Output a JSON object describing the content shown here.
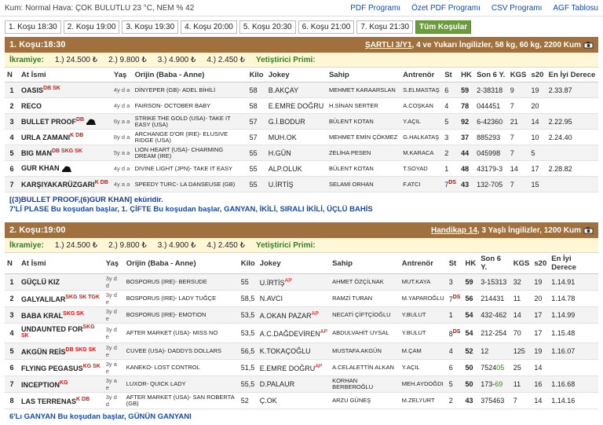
{
  "header": {
    "weather": "Kum: Normal Hava: ÇOK BULUTLU 23 °C, NEM % 42",
    "links": [
      "PDF Programı",
      "Özet PDF Programı",
      "CSV Programı",
      "AGF Tablosu"
    ]
  },
  "tabs": [
    "1. Koşu 18:30",
    "2. Koşu 19:00",
    "3. Koşu 19:30",
    "4. Koşu 20:00",
    "5. Koşu 20:30",
    "6. Koşu 21:00",
    "7. Koşu 21:30",
    "Tüm Koşular"
  ],
  "columns": [
    "N",
    "At İsmi",
    "Yaş",
    "Orijin (Baba - Anne)",
    "Kilo",
    "Jokey",
    "Sahip",
    "Antrenör",
    "St",
    "HK",
    "Son 6 Y.",
    "KGS",
    "s20",
    "En İyi Derece"
  ],
  "races": [
    {
      "title": "1. Koşu:18:30",
      "cond_link": "ŞARTLI 3/Y1",
      "cond_rest": ", 4 ve Yukarı İngilizler, 58 kg, 60 kg, 2200 Kum",
      "prize_label": "İkramiye:",
      "prizes": [
        "1.) 24.500 ₺",
        "2.) 9.800 ₺",
        "3.) 4.900 ₺",
        "4.) 2.450 ₺"
      ],
      "breeder": "Yetiştirici Primi:",
      "runners": [
        {
          "n": "1",
          "name": "OASIS",
          "sup": "DB SK",
          "age": "4y d a",
          "origin": "DİNYEPER (GB)- ADEL BİHİLİ",
          "kilo": "58",
          "jockey": "B.AKÇAY",
          "jsup": "",
          "owner": "MEHMET KARAARSLAN",
          "trainer": "S.ELMASTAŞ",
          "st": "6",
          "ds": "",
          "hk": "59",
          "son": "2-38318",
          "songreen": "",
          "kgs": "9",
          "s20": "19",
          "best": "2.33.87",
          "helmet": false
        },
        {
          "n": "2",
          "name": "RECO",
          "sup": "",
          "age": "4y d a",
          "origin": "FAIRSON- OCTOBER BABY",
          "kilo": "58",
          "jockey": "E.EMRE DOĞRU",
          "jsup": "",
          "owner": "H.SİNAN SERTER",
          "trainer": "A.COŞKAN",
          "st": "4",
          "ds": "",
          "hk": "78",
          "son": "044451",
          "songreen": "",
          "kgs": "7",
          "s20": "20",
          "best": "",
          "helmet": false
        },
        {
          "n": "3",
          "name": "BULLET PROOF",
          "sup": "DB",
          "age": "6y a a",
          "origin": "STRIKE THE GOLD (USA)- TAKE IT EASY (USA)",
          "kilo": "57",
          "jockey": "G.İ.BODUR",
          "jsup": "",
          "owner": "BÜLENT KOTAN",
          "trainer": "Y.AÇIL",
          "st": "5",
          "ds": "",
          "hk": "92",
          "son": "6-42360",
          "songreen": "",
          "kgs": "21",
          "s20": "14",
          "best": "2.22.95",
          "helmet": true
        },
        {
          "n": "4",
          "name": "URLA ZAMANI",
          "sup": "K DB",
          "age": "8y d a",
          "origin": "ARCHANGE D'OR (IRE)- ELUSIVE RIDGE (USA)",
          "kilo": "57",
          "jockey": "MUH.OK",
          "jsup": "",
          "owner": "MEHMET EMİN ÇÖKMEZ",
          "trainer": "G.HALKATAŞ",
          "st": "3",
          "ds": "",
          "hk": "37",
          "son": "885293",
          "songreen": "",
          "kgs": "7",
          "s20": "10",
          "best": "2.24.40",
          "helmet": false
        },
        {
          "n": "5",
          "name": "BIG MAN",
          "sup": "DB SKG SK",
          "age": "5y a a",
          "origin": "LION HEART (USA)- CHARMING DREAM (IRE)",
          "kilo": "55",
          "jockey": "H.GÜN",
          "jsup": "",
          "owner": "ZELİHA PESEN",
          "trainer": "M.KARACA",
          "st": "2",
          "ds": "",
          "hk": "44",
          "son": "045998",
          "songreen": "",
          "kgs": "7",
          "s20": "5",
          "best": "",
          "helmet": false
        },
        {
          "n": "6",
          "name": "GUR KHAN",
          "sup": "",
          "age": "4y d a",
          "origin": "DIVINE LIGHT (JPN)- TAKE IT EASY",
          "kilo": "55",
          "jockey": "ALP.OLUK",
          "jsup": "",
          "owner": "BÜLENT KOTAN",
          "trainer": "T.SOYAD",
          "st": "1",
          "ds": "",
          "hk": "48",
          "son": "43179-3",
          "songreen": "",
          "kgs": "14",
          "s20": "17",
          "best": "2.28.82",
          "helmet": true
        },
        {
          "n": "7",
          "name": "KARŞIYAKARÜZGARI",
          "sup": "K DB",
          "age": "4y a a",
          "origin": "SPEEDY TURC- LA DANSEUSE (GB)",
          "kilo": "55",
          "jockey": "U.İRTİŞ",
          "jsup": "",
          "owner": "SELAMİ ORHAN",
          "trainer": "F.ATCI",
          "st": "7",
          "ds": "DS",
          "hk": "43",
          "son": "132-705",
          "songreen": "",
          "kgs": "7",
          "s20": "15",
          "best": "",
          "helmet": false
        }
      ],
      "note_lines": [
        {
          "text": "[(3)BULLET PROOF,(6)GUR KHAN] eküridir.",
          "cls": "dark"
        },
        {
          "text": "7'Lİ PLASE Bu koşudan başlar, 1. ÇİFTE Bu koşudan başlar, GANYAN, İKİLİ, SIRALI İKİLİ, ÜÇLÜ BAHİS",
          "cls": "blue"
        }
      ]
    },
    {
      "title": "2. Koşu:19:00",
      "cond_link": "Handikap 14",
      "cond_rest": ", 3 Yaşlı İngilizler, 1200 Kum",
      "prize_label": "İkramiye:",
      "prizes": [
        "1.) 24.500 ₺",
        "2.) 9.800 ₺",
        "3.) 4.900 ₺",
        "4.) 2.450 ₺"
      ],
      "breeder": "Yetiştirici Primi:",
      "runners": [
        {
          "n": "1",
          "name": "GÜÇLÜ KIZ",
          "sup": "",
          "age": "3y d d",
          "origin": "BOSPORUS (IRE)- BERSUDE",
          "kilo": "55",
          "jockey": "U.İRTİŞ",
          "jsup": "AP",
          "owner": "AHMET ÖZÇİLNAK",
          "trainer": "MUT.KAYA",
          "st": "3",
          "ds": "",
          "hk": "59",
          "son": "3-15313",
          "songreen": "",
          "kgs": "32",
          "s20": "19",
          "best": "1.14.91",
          "helmet": false
        },
        {
          "n": "2",
          "name": "GALYALILAR",
          "sup": "SKG SK TGK",
          "age": "3y d e",
          "origin": "BOSPORUS (IRE)- LADY TUĞÇE",
          "kilo": "58,5",
          "jockey": "N.AVCI",
          "jsup": "",
          "owner": "RAMZİ TURAN",
          "trainer": "M.YAPAROĞLU",
          "st": "7",
          "ds": "DS",
          "hk": "56",
          "son": "214431",
          "songreen": "",
          "kgs": "11",
          "s20": "20",
          "best": "1.14.78",
          "helmet": false
        },
        {
          "n": "3",
          "name": "BABA KRAL",
          "sup": "SKG SK",
          "age": "3y d e",
          "origin": "BOSPORUS (IRE)- EMOTION",
          "kilo": "53,5",
          "jockey": "A.OKAN PAZAR",
          "jsup": "AP",
          "owner": "NECATİ ÇİFTÇİOĞLU",
          "trainer": "Y.BULUT",
          "st": "1",
          "ds": "",
          "hk": "54",
          "son": "432-462",
          "songreen": "",
          "kgs": "14",
          "s20": "17",
          "best": "1.14.99",
          "helmet": false
        },
        {
          "n": "4",
          "name": "UNDAUNTED FOR",
          "sup": "SKG SK",
          "age": "3y d e",
          "origin": "AFTER MARKET (USA)- MISS NO",
          "kilo": "53,5",
          "jockey": "A.C.DAĞDEVİREN",
          "jsup": "AP",
          "owner": "ABDULVAHİT UYSAL",
          "trainer": "Y.BULUT",
          "st": "8",
          "ds": "DS",
          "hk": "54",
          "son": "212-254",
          "songreen": "",
          "kgs": "70",
          "s20": "17",
          "best": "1.15.48",
          "helmet": false
        },
        {
          "n": "5",
          "name": "AKGÜN REİS",
          "sup": "DB SKG SK",
          "age": "3y d e",
          "origin": "CUVEE (USA)- DADDYS DOLLARS",
          "kilo": "56,5",
          "jockey": "K.TOKAÇOĞLU",
          "jsup": "",
          "owner": "MUSTAFA AKGÜN",
          "trainer": "M.ÇAM",
          "st": "4",
          "ds": "",
          "hk": "52",
          "son": "12",
          "songreen": "",
          "kgs": "125",
          "s20": "19",
          "best": "1.16.07",
          "helmet": false
        },
        {
          "n": "6",
          "name": "FLYING PEGASUS",
          "sup": "KG SK",
          "age": "3y a e",
          "origin": "KANEKO- LOST CONTROL",
          "kilo": "51,5",
          "jockey": "E.EMRE DOĞRU",
          "jsup": "AP",
          "owner": "A.CELALETTİN ALKAN",
          "trainer": "Y.AÇIL",
          "st": "6",
          "ds": "",
          "hk": "50",
          "son": "7524",
          "songreen": "05",
          "kgs": "25",
          "s20": "14",
          "best": "",
          "helmet": false
        },
        {
          "n": "7",
          "name": "INCEPTION",
          "sup": "KG",
          "age": "3y a e",
          "origin": "LUXOR- QUICK LADY",
          "kilo": "55,5",
          "jockey": "D.PALAUR",
          "jsup": "",
          "owner": "KORHAN BERBEROĞLU",
          "trainer": "MEH.AYDOĞDI",
          "st": "5",
          "ds": "",
          "hk": "50",
          "son": "173-",
          "songreen": "69",
          "kgs": "11",
          "s20": "16",
          "best": "1.16.68",
          "helmet": false
        },
        {
          "n": "8",
          "name": "LAS TERRENAS",
          "sup": "K DB",
          "age": "3y d d",
          "origin": "AFTER MARKET (USA)- SAN ROBERTA (GB)",
          "kilo": "52",
          "jockey": "Ç.OK",
          "jsup": "",
          "owner": "ARZU GÜNEŞ",
          "trainer": "M.ZELYURT",
          "st": "2",
          "ds": "",
          "hk": "43",
          "son": "375463",
          "songreen": "",
          "kgs": "7",
          "s20": "14",
          "best": "1.14.16",
          "helmet": false
        }
      ],
      "note_lines": [
        {
          "text": "6'Lı GANYAN Bu koşudan başlar, GÜNÜN GANYANI",
          "cls": "blue"
        }
      ]
    }
  ]
}
